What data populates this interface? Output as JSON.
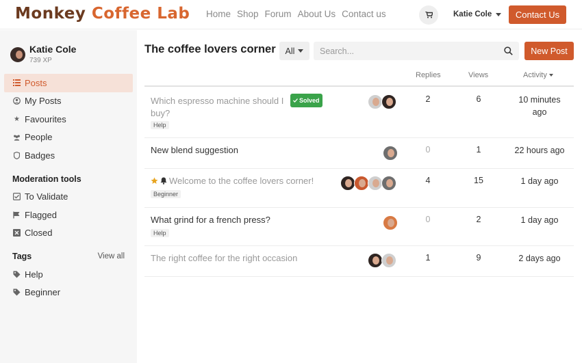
{
  "header": {
    "logo_word1": "Monkey",
    "logo_word2": "Coffee Lab",
    "nav": [
      "Home",
      "Shop",
      "Forum",
      "About Us",
      "Contact us"
    ],
    "user_name": "Katie Cole",
    "contact_button": "Contact Us"
  },
  "sidebar": {
    "profile_name": "Katie Cole",
    "profile_xp": "739 XP",
    "items": [
      {
        "label": "Posts",
        "icon": "list-icon"
      },
      {
        "label": "My Posts",
        "icon": "user-circle-icon"
      },
      {
        "label": "Favourites",
        "icon": "star-icon"
      },
      {
        "label": "People",
        "icon": "users-icon"
      },
      {
        "label": "Badges",
        "icon": "shield-icon"
      }
    ],
    "moderation_heading": "Moderation tools",
    "moderation_items": [
      {
        "label": "To Validate",
        "icon": "check-square-icon"
      },
      {
        "label": "Flagged",
        "icon": "flag-icon"
      },
      {
        "label": "Closed",
        "icon": "close-box-icon"
      }
    ],
    "tags_heading": "Tags",
    "view_all": "View all",
    "tags": [
      {
        "label": "Help",
        "icon": "tag-icon"
      },
      {
        "label": "Beginner",
        "icon": "tag-icon"
      }
    ]
  },
  "main": {
    "title": "The coffee lovers corner",
    "filter_value": "All",
    "search_placeholder": "Search...",
    "new_post_button": "New Post",
    "columns": {
      "replies": "Replies",
      "views": "Views",
      "activity": "Activity"
    },
    "posts": [
      {
        "title_line1": "Which espresso machine should I",
        "title_line2": "buy?",
        "badge": "Solved",
        "tag": "Help",
        "replies": "2",
        "views": "6",
        "activity_line1": "10 minutes",
        "activity_line2": "ago"
      },
      {
        "title": "New blend suggestion",
        "replies": "0",
        "views": "1",
        "activity": "22 hours ago"
      },
      {
        "title": "Welcome to the coffee lovers corner!",
        "tag": "Beginner",
        "replies": "4",
        "views": "15",
        "activity": "1 day ago"
      },
      {
        "title": "What grind for a french press?",
        "tag": "Help",
        "replies": "0",
        "views": "2",
        "activity": "1 day ago"
      },
      {
        "title": "The right coffee for the right occasion",
        "replies": "1",
        "views": "9",
        "activity": "2 days ago"
      }
    ]
  }
}
